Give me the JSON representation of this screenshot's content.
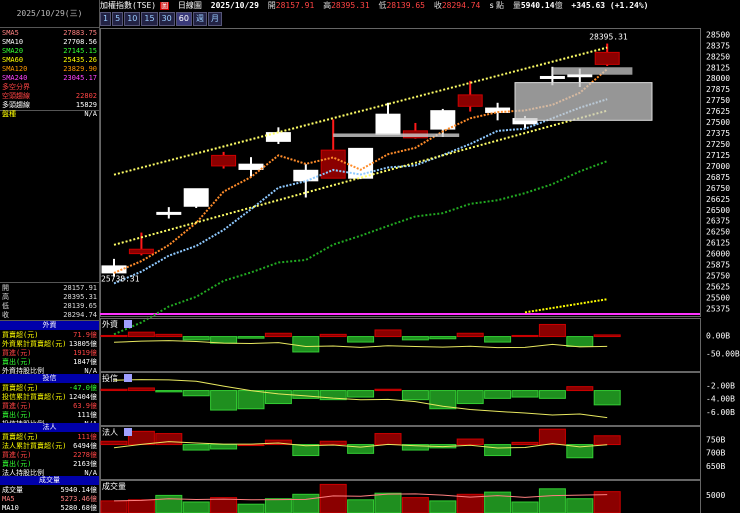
{
  "left": {
    "date": "2025/10/29(三)",
    "ma_rows": [
      {
        "k": "SMA5",
        "v": "27883.75",
        "kc": "#ff8080",
        "vc": "#ff8080"
      },
      {
        "k": "SMA10",
        "v": "27708.56",
        "kc": "#ffffff",
        "vc": "#ffffff"
      },
      {
        "k": "SMA20",
        "v": "27145.15",
        "kc": "#33ff33",
        "vc": "#33ff33"
      },
      {
        "k": "SMA60",
        "v": "25435.26",
        "kc": "#ffff00",
        "vc": "#ffff00"
      },
      {
        "k": "SMA120",
        "v": "23829.90",
        "kc": "#ff9900",
        "vc": "#ff9900"
      },
      {
        "k": "SMA240",
        "v": "23045.17",
        "kc": "#ff44ff",
        "vc": "#ff44ff"
      },
      {
        "k": "多空分界",
        "v": "",
        "kc": "#ff4444",
        "vc": "#ff4444"
      },
      {
        "k": "空頭趨線",
        "v": "22802",
        "kc": "#ff4444",
        "vc": "#ff4444"
      },
      {
        "k": "多頭趨線",
        "v": "15829",
        "kc": "#ffffff",
        "vc": "#ffffff"
      },
      {
        "k": "盤種",
        "v": "N/A",
        "kc": "#ffff00",
        "vc": "#ffffff"
      }
    ],
    "ohlc": [
      {
        "k": "開",
        "v": "28157.91"
      },
      {
        "k": "高",
        "v": "28395.31"
      },
      {
        "k": "低",
        "v": "28139.65"
      },
      {
        "k": "收",
        "v": "28294.74"
      }
    ],
    "foreign_title": "外資",
    "foreign_rows": [
      {
        "k": "買賣超(元)",
        "v": "71.9億",
        "kc": "#ffff00",
        "vc": "#ff4444"
      },
      {
        "k": "外資累計買賣超(元)",
        "v": "13805億",
        "kc": "#ffff00",
        "vc": "#ffffff"
      },
      {
        "k": "買進(元)",
        "v": "1919億",
        "kc": "#ff4444",
        "vc": "#ff4444"
      },
      {
        "k": "賣出(元)",
        "v": "1847億",
        "kc": "#33ff33",
        "vc": "#ffffff"
      },
      {
        "k": "外資持股比例",
        "v": "N/A",
        "kc": "#ffffff",
        "vc": "#ffffff"
      }
    ],
    "trust_title": "投信",
    "trust_rows": [
      {
        "k": "買賣超(元)",
        "v": "-47.0億",
        "kc": "#ffff00",
        "vc": "#33ff33"
      },
      {
        "k": "投信累計買賣超(元)",
        "v": "12404億",
        "kc": "#ffff00",
        "vc": "#ffffff"
      },
      {
        "k": "買進(元)",
        "v": "63.9億",
        "kc": "#ff4444",
        "vc": "#ff4444"
      },
      {
        "k": "賣出(元)",
        "v": "111億",
        "kc": "#33ff33",
        "vc": "#ffffff"
      },
      {
        "k": "投信持股比例",
        "v": "N/A",
        "kc": "#ffffff",
        "vc": "#ffffff"
      }
    ],
    "inst_title": "法人",
    "inst_rows": [
      {
        "k": "買賣超(元)",
        "v": "111億",
        "kc": "#ffff00",
        "vc": "#ff4444"
      },
      {
        "k": "法人累計買賣超(元)",
        "v": "6494億",
        "kc": "#ffff00",
        "vc": "#ffffff"
      },
      {
        "k": "買進(元)",
        "v": "2278億",
        "kc": "#ff4444",
        "vc": "#ff4444"
      },
      {
        "k": "賣出(元)",
        "v": "2163億",
        "kc": "#33ff33",
        "vc": "#ffffff"
      },
      {
        "k": "法人持股比例",
        "v": "N/A",
        "kc": "#ffffff",
        "vc": "#ffffff"
      }
    ],
    "vol_title": "成交量",
    "vol_rows": [
      {
        "k": "成交量",
        "v": "5940.14億",
        "kc": "#ffffff",
        "vc": "#ffffff"
      },
      {
        "k": "MA5",
        "v": "5273.46億",
        "kc": "#ff8080",
        "vc": "#ff8080"
      },
      {
        "k": "MA10",
        "v": "5280.68億",
        "kc": "#ffffff",
        "vc": "#ffffff"
      }
    ]
  },
  "topbar": {
    "index_name": "加權指數(TSE)",
    "flag": "圖",
    "chart_type": "日線圖",
    "date": "2025/10/29",
    "open_label": "開",
    "open": "28157.91",
    "high_label": "高",
    "high": "28395.31",
    "low_label": "低",
    "low": "28139.65",
    "close_label": "收",
    "close": "28294.74",
    "unit": "s",
    "pts_label": "點",
    "vol_label": "量",
    "volume": "5940.14",
    "vol_unit": "億",
    "change": "+345.63 (+1.24%)"
  },
  "periods": {
    "buttons": [
      "1",
      "5",
      "10",
      "15",
      "30",
      "60",
      "週",
      "月"
    ],
    "selected": "60"
  },
  "panels": {
    "foreign": "外資",
    "trust": "投信",
    "inst": "法人",
    "volume": "成交量",
    "foreign_ticks": [
      "0.00B",
      "-50.00B"
    ],
    "trust_ticks": [
      "-2.00B",
      "-4.00B",
      "-6.00B"
    ],
    "inst_ticks": [
      "750B",
      "700B",
      "650B"
    ],
    "volume_ticks": [
      "5000"
    ]
  },
  "chart_data": {
    "type": "candlestick",
    "price_axis": [
      "28500",
      "28375",
      "28250",
      "28125",
      "28000",
      "27875",
      "27750",
      "27625",
      "27500",
      "27375",
      "27250",
      "27125",
      "27000",
      "26875",
      "26750",
      "26625",
      "26500",
      "26375",
      "26250",
      "26125",
      "26000",
      "25875",
      "25750",
      "25625",
      "25500",
      "25375"
    ],
    "ylim": [
      25300,
      28550
    ],
    "high_label": "28395.31",
    "low_label": "25738.31",
    "candles": [
      {
        "o": 25860,
        "h": 25940,
        "l": 25738,
        "c": 25780
      },
      {
        "o": 26000,
        "h": 26240,
        "l": 25980,
        "c": 26050
      },
      {
        "o": 26470,
        "h": 26530,
        "l": 26400,
        "c": 26460
      },
      {
        "o": 26740,
        "h": 26740,
        "l": 26520,
        "c": 26540
      },
      {
        "o": 27000,
        "h": 27160,
        "l": 26970,
        "c": 27120
      },
      {
        "o": 27020,
        "h": 27100,
        "l": 26880,
        "c": 26960
      },
      {
        "o": 27380,
        "h": 27440,
        "l": 27250,
        "c": 27280
      },
      {
        "o": 26950,
        "h": 27020,
        "l": 26640,
        "c": 26830
      },
      {
        "o": 26860,
        "h": 27530,
        "l": 26860,
        "c": 27180
      },
      {
        "o": 27200,
        "h": 27200,
        "l": 26850,
        "c": 26860
      },
      {
        "o": 27590,
        "h": 27720,
        "l": 27510,
        "c": 27360
      },
      {
        "o": 27320,
        "h": 27490,
        "l": 27310,
        "c": 27400
      },
      {
        "o": 27630,
        "h": 27650,
        "l": 27330,
        "c": 27420
      },
      {
        "o": 27680,
        "h": 27970,
        "l": 27620,
        "c": 27810
      },
      {
        "o": 27660,
        "h": 27720,
        "l": 27520,
        "c": 27610
      },
      {
        "o": 27540,
        "h": 27570,
        "l": 27430,
        "c": 27480
      },
      {
        "o": 28020,
        "h": 28130,
        "l": 27920,
        "c": 28000
      },
      {
        "o": 28040,
        "h": 28110,
        "l": 27900,
        "c": 28020
      },
      {
        "o": 28157.91,
        "h": 28395.31,
        "l": 28139.65,
        "c": 28294.74
      }
    ],
    "foreign_net": [
      2,
      8,
      4,
      -6,
      -12,
      -3,
      6,
      -28,
      4,
      -10,
      12,
      -6,
      -4,
      6,
      -10,
      2,
      22,
      -18,
      3
    ],
    "trust_net": [
      1,
      2,
      -1,
      -4,
      -15,
      -14,
      -10,
      -6,
      -7,
      -5,
      1,
      -7,
      -14,
      -10,
      -6,
      -5,
      -6,
      3,
      -11
    ],
    "inst_net": [
      3,
      12,
      10,
      -5,
      -4,
      0,
      4,
      -10,
      3,
      -8,
      10,
      -5,
      -3,
      5,
      -10,
      2,
      14,
      -12,
      8
    ],
    "volume": [
      5100,
      5200,
      5600,
      5000,
      5400,
      4800,
      5300,
      5700,
      6600,
      5200,
      5800,
      5400,
      5100,
      5700,
      5900,
      5000,
      6200,
      5300,
      5940
    ]
  }
}
